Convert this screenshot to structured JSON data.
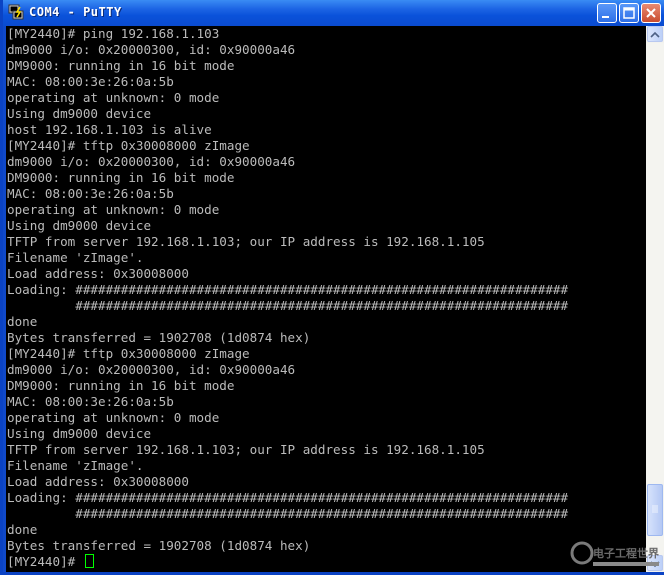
{
  "window": {
    "title": "COM4 - PuTTY",
    "titlebar_color": "#0A52DA"
  },
  "terminal": {
    "background": "#000000",
    "foreground": "#BBBBBB",
    "cursor_color": "#00FF00",
    "lines": [
      "[MY2440]# ping 192.168.1.103",
      "dm9000 i/o: 0x20000300, id: 0x90000a46",
      "DM9000: running in 16 bit mode",
      "MAC: 08:00:3e:26:0a:5b",
      "operating at unknown: 0 mode",
      "Using dm9000 device",
      "host 192.168.1.103 is alive",
      "[MY2440]# tftp 0x30008000 zImage",
      "dm9000 i/o: 0x20000300, id: 0x90000a46",
      "DM9000: running in 16 bit mode",
      "MAC: 08:00:3e:26:0a:5b",
      "operating at unknown: 0 mode",
      "Using dm9000 device",
      "TFTP from server 192.168.1.103; our IP address is 192.168.1.105",
      "Filename 'zImage'.",
      "Load address: 0x30008000",
      "Loading: #################################################################",
      "         #################################################################",
      "done",
      "Bytes transferred = 1902708 (1d0874 hex)",
      "[MY2440]# tftp 0x30008000 zImage",
      "dm9000 i/o: 0x20000300, id: 0x90000a46",
      "DM9000: running in 16 bit mode",
      "MAC: 08:00:3e:26:0a:5b",
      "operating at unknown: 0 mode",
      "Using dm9000 device",
      "TFTP from server 192.168.1.103; our IP address is 192.168.1.105",
      "Filename 'zImage'.",
      "Load address: 0x30008000",
      "Loading: #################################################################",
      "         #################################################################",
      "done",
      "Bytes transferred = 1902708 (1d0874 hex)"
    ],
    "prompt": "[MY2440]# "
  },
  "icons": {
    "app": "putty-icon",
    "minimize": "minimize-icon",
    "maximize": "maximize-icon",
    "close": "close-icon",
    "scroll_up": "scroll-up-arrow-icon",
    "scroll_down": "scroll-down-arrow-icon"
  },
  "watermark": {
    "text": "电子工程世界"
  }
}
